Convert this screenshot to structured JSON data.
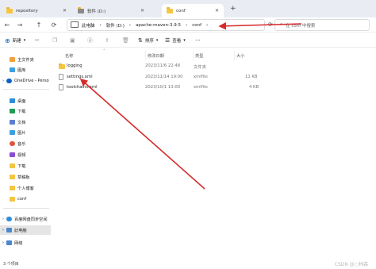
{
  "tabs": [
    {
      "label": "repository"
    },
    {
      "label": "软件 (D:)"
    },
    {
      "label": "conf"
    }
  ],
  "breadcrumb": [
    "此电脑",
    "软件 (D:)",
    "apache-maven-3.9.5",
    "conf"
  ],
  "search_placeholder": "在 conf 中搜索",
  "toolbar": {
    "new_label": "新建",
    "sort_label": "排序",
    "view_label": "查看"
  },
  "columns": {
    "name": "名称",
    "date": "修改日期",
    "type": "类型",
    "size": "大小"
  },
  "sidebar": {
    "items": [
      {
        "label": "主文件夹",
        "icon": "home-icon"
      },
      {
        "label": "图库",
        "icon": "gallery-icon"
      },
      {
        "label": "OneDrive - Perso",
        "icon": "cloud-icon"
      },
      {
        "label": "桌面",
        "icon": "desktop-icon"
      },
      {
        "label": "下载",
        "icon": "download-icon"
      },
      {
        "label": "文档",
        "icon": "document-icon"
      },
      {
        "label": "图片",
        "icon": "picture-icon"
      },
      {
        "label": "音乐",
        "icon": "music-icon"
      },
      {
        "label": "视频",
        "icon": "video-icon"
      },
      {
        "label": "下载",
        "icon": "folder-icon"
      },
      {
        "label": "草稿板",
        "icon": "folder-icon"
      },
      {
        "label": "个人博客",
        "icon": "folder-icon"
      },
      {
        "label": "conf",
        "icon": "folder-icon"
      },
      {
        "label": "百度网盘同步空间",
        "icon": "cloud-sync-icon"
      },
      {
        "label": "此电脑",
        "icon": "computer-icon"
      },
      {
        "label": "网络",
        "icon": "network-icon"
      }
    ]
  },
  "files": [
    {
      "name": "logging",
      "date": "2023/11/6 22:48",
      "type": "文件夹",
      "size": ""
    },
    {
      "name": "settings.xml",
      "date": "2023/11/14 19:00",
      "type": "xmlfile",
      "size": "11 KB"
    },
    {
      "name": "toolchains.xml",
      "date": "2023/10/1 13:00",
      "type": "xmlfile",
      "size": "4 KB"
    }
  ],
  "status": {
    "count": "3 个项目"
  },
  "watermark": "CSDN @○林森"
}
